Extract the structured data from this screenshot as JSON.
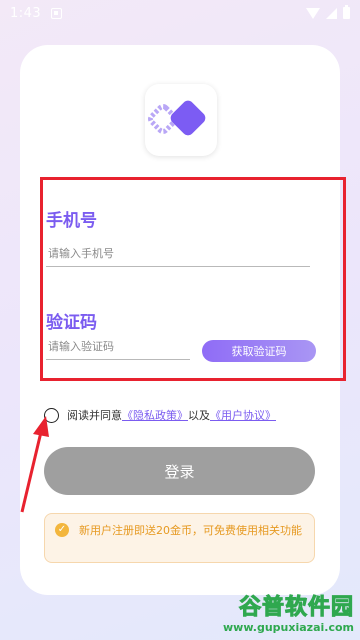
{
  "status_bar": {
    "time": "1:43"
  },
  "form": {
    "phone_label": "手机号",
    "phone_placeholder": "请输入手机号",
    "code_label": "验证码",
    "code_placeholder": "请输入验证码",
    "get_code_button": "获取验证码"
  },
  "agreement": {
    "prefix": "阅读并同意",
    "privacy_link": "《隐私政策》",
    "middle": "以及",
    "terms_link": "《用户协议》"
  },
  "login_button": "登录",
  "notice": {
    "text": "新用户注册即送20金币，可免费使用相关功能"
  },
  "watermark": {
    "title": "谷普软件园",
    "url": "www.gupuxiazai.com"
  },
  "colors": {
    "accent": "#7b5cf0",
    "highlight_red": "#e8222f",
    "login_disabled": "#9f9f9f",
    "notice_text": "#e69a22"
  },
  "icons": [
    "notification-icon",
    "wifi-icon",
    "signal-icon",
    "battery-icon",
    "app-logo-icon",
    "check-circle-icon",
    "radio-unchecked-icon",
    "red-arrow-annotation"
  ]
}
